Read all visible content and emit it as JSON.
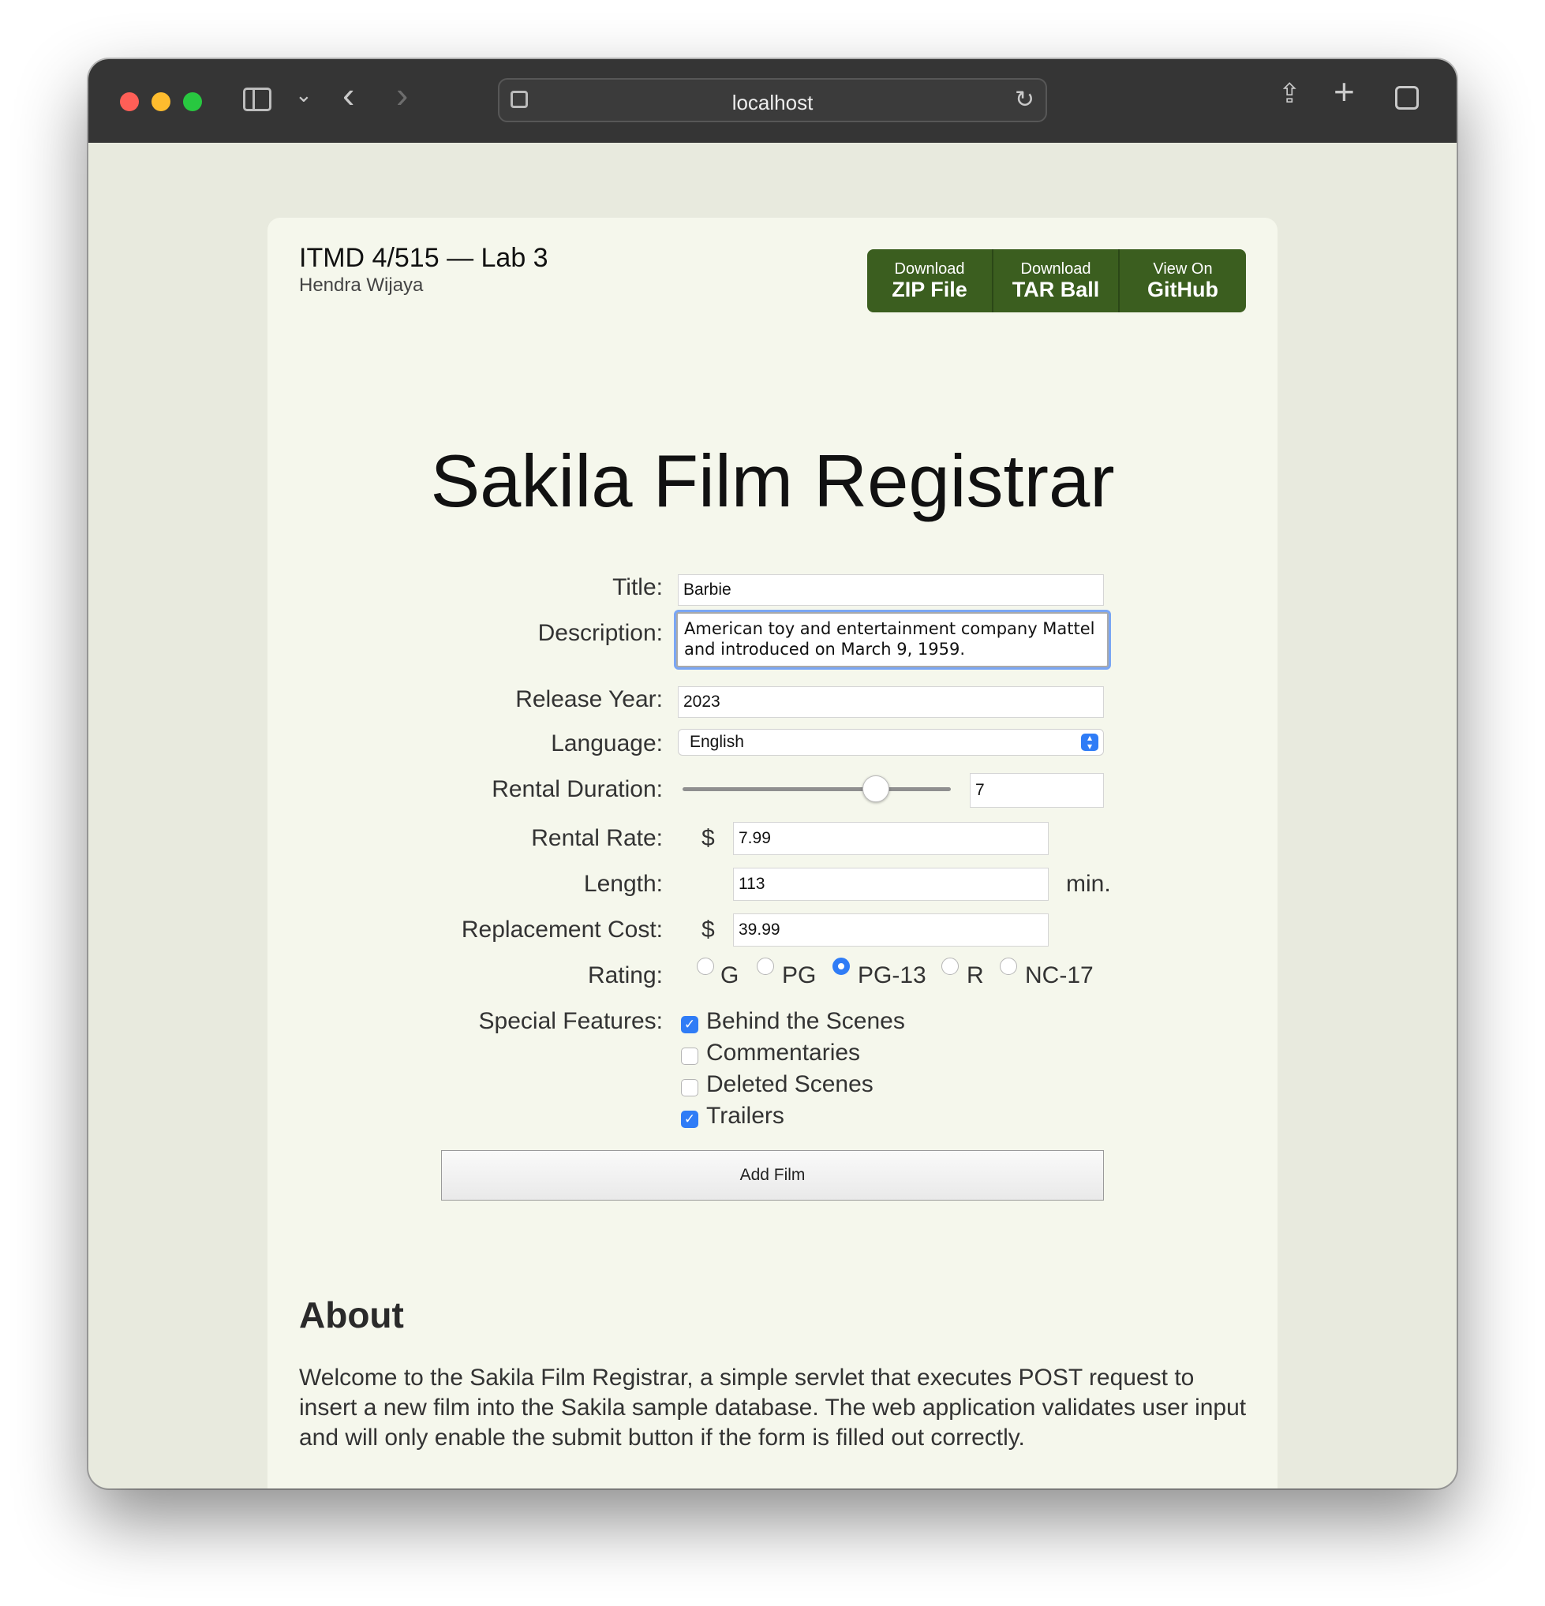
{
  "browser": {
    "url": "localhost"
  },
  "header": {
    "title": "ITMD 4/515 — Lab 3",
    "author": "Hendra Wijaya",
    "buttons": [
      {
        "small": "Download",
        "big": "ZIP File"
      },
      {
        "small": "Download",
        "big": "TAR Ball"
      },
      {
        "small": "View On",
        "big": "GitHub"
      }
    ],
    "button_color": "#3b5e1f"
  },
  "form": {
    "heading": "Sakila Film Registrar",
    "title_label": "Title:",
    "title_value": "Barbie",
    "description_label": "Description:",
    "description_value": "American toy and entertainment company Mattel and introduced on March 9, 1959.",
    "release_year_label": "Release Year:",
    "release_year_value": "2023",
    "language_label": "Language:",
    "language_value": "English",
    "rental_duration_label": "Rental Duration:",
    "rental_duration_value": "7",
    "rental_rate_label": "Rental Rate:",
    "rental_rate_value": "7.99",
    "length_label": "Length:",
    "length_value": "113",
    "length_unit": "min.",
    "replacement_cost_label": "Replacement Cost:",
    "replacement_cost_value": "39.99",
    "currency_symbol": "$",
    "rating_label": "Rating:",
    "ratings": [
      "G",
      "PG",
      "PG-13",
      "R",
      "NC-17"
    ],
    "rating_selected": "PG-13",
    "special_features_label": "Special Features:",
    "features": [
      {
        "label": "Behind the Scenes",
        "checked": true
      },
      {
        "label": "Commentaries",
        "checked": false
      },
      {
        "label": "Deleted Scenes",
        "checked": false
      },
      {
        "label": "Trailers",
        "checked": true
      }
    ],
    "submit_label": "Add Film",
    "accent_color": "#2f7cf6"
  },
  "about": {
    "heading": "About",
    "text": "Welcome to the Sakila Film Registrar, a simple servlet that executes POST request to insert a new film into the Sakila sample database. The web application validates user input and will only enable the submit button if the form is filled out correctly."
  }
}
